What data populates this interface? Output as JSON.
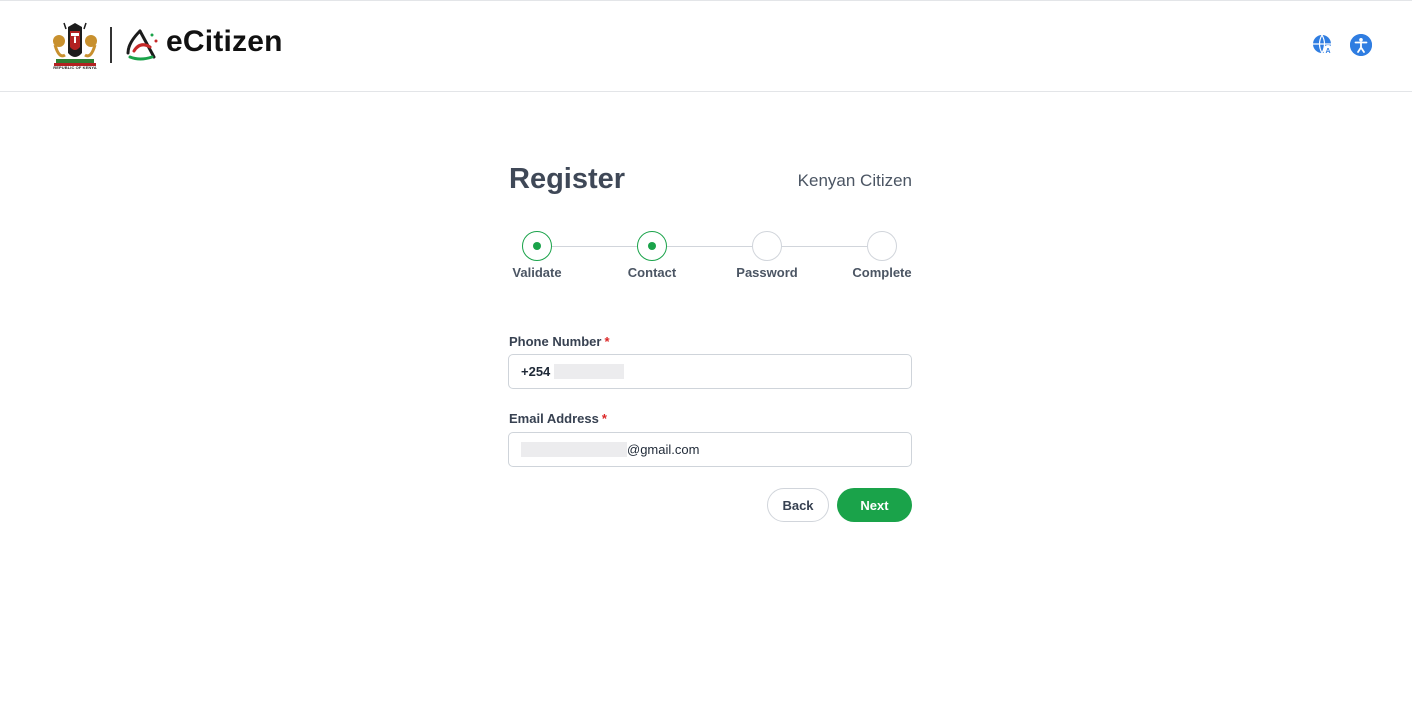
{
  "header": {
    "coat_caption": "REPUBLIC OF KENYA",
    "brand": "eCitizen",
    "icons": [
      "language-icon",
      "accessibility-icon"
    ]
  },
  "register": {
    "title": "Register",
    "subtitle": "Kenyan Citizen"
  },
  "stepper": {
    "steps": [
      {
        "label": "Validate",
        "status": "done"
      },
      {
        "label": "Contact",
        "status": "done"
      },
      {
        "label": "Password",
        "status": "pending"
      },
      {
        "label": "Complete",
        "status": "pending"
      }
    ]
  },
  "form": {
    "phone_label": "Phone Number",
    "phone_prefix": "+254",
    "email_label": "Email Address",
    "email_suffix": "@gmail.com",
    "required_mark": "*"
  },
  "buttons": {
    "back": "Back",
    "next": "Next"
  },
  "colors": {
    "accent": "#1aa34a",
    "required": "#dc2626",
    "icon_blue": "#2f7de1"
  }
}
